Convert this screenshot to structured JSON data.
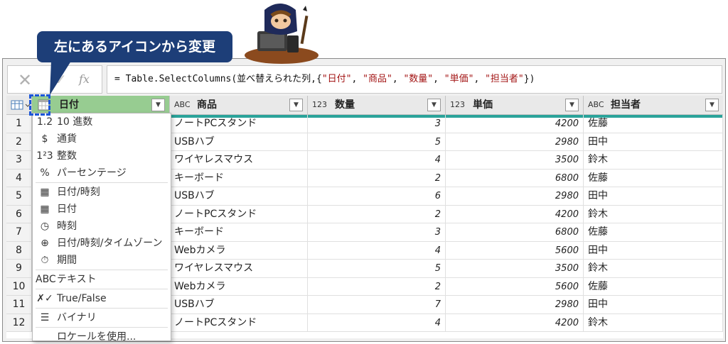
{
  "callout": {
    "text": "左にあるアイコンから変更"
  },
  "formula": {
    "cancel_icon": "close-icon",
    "confirm_icon": "check-icon",
    "fx_label": "fx",
    "prefix": "= Table.SelectColumns(並べ替えられた列,{",
    "args": [
      "\"日付\"",
      "\"商品\"",
      "\"数量\"",
      "\"単価\"",
      "\"担当者\""
    ],
    "sep": ", ",
    "suffix": "})"
  },
  "columns": [
    {
      "type": "date",
      "label": "日付"
    },
    {
      "type": "ABC",
      "label": "商品"
    },
    {
      "type": "123",
      "label": "数量"
    },
    {
      "type": "123",
      "label": "単価"
    },
    {
      "type": "ABC",
      "label": "担当者"
    }
  ],
  "row_numbers": [
    "1",
    "2",
    "3",
    "4",
    "5",
    "6",
    "7",
    "8",
    "9",
    "10",
    "11",
    "12"
  ],
  "rows": [
    {
      "product": "ノートPCスタンド",
      "qty": "3",
      "price": "4200",
      "person": "佐藤"
    },
    {
      "product": "USBハブ",
      "qty": "5",
      "price": "2980",
      "person": "田中"
    },
    {
      "product": "ワイヤレスマウス",
      "qty": "4",
      "price": "3500",
      "person": "鈴木"
    },
    {
      "product": "キーボード",
      "qty": "2",
      "price": "6800",
      "person": "佐藤"
    },
    {
      "product": "USBハブ",
      "qty": "6",
      "price": "2980",
      "person": "田中"
    },
    {
      "product": "ノートPCスタンド",
      "qty": "2",
      "price": "4200",
      "person": "鈴木"
    },
    {
      "product": "キーボード",
      "qty": "3",
      "price": "6800",
      "person": "佐藤"
    },
    {
      "product": "Webカメラ",
      "qty": "4",
      "price": "5600",
      "person": "田中"
    },
    {
      "product": "ワイヤレスマウス",
      "qty": "5",
      "price": "3500",
      "person": "鈴木"
    },
    {
      "product": "Webカメラ",
      "qty": "2",
      "price": "5600",
      "person": "佐藤"
    },
    {
      "product": "USBハブ",
      "qty": "7",
      "price": "2980",
      "person": "田中"
    },
    {
      "product": "ノートPCスタンド",
      "qty": "4",
      "price": "4200",
      "person": "鈴木"
    }
  ],
  "type_menu": {
    "groups": [
      [
        {
          "icon": "decimal-icon",
          "glyph": "1.2",
          "label": "10 進数"
        },
        {
          "icon": "currency-icon",
          "glyph": "$",
          "label": "通貨"
        },
        {
          "icon": "integer-icon",
          "glyph": "1²3",
          "label": "整数"
        },
        {
          "icon": "percent-icon",
          "glyph": "%",
          "label": "パーセンテージ"
        }
      ],
      [
        {
          "icon": "datetime-icon",
          "glyph": "▦",
          "label": "日付/時刻"
        },
        {
          "icon": "date-icon",
          "glyph": "▦",
          "label": "日付"
        },
        {
          "icon": "time-icon",
          "glyph": "◷",
          "label": "時刻"
        },
        {
          "icon": "datetimezone-icon",
          "glyph": "⊕",
          "label": "日付/時刻/タイムゾーン"
        },
        {
          "icon": "duration-icon",
          "glyph": "⏱",
          "label": "期間"
        }
      ],
      [
        {
          "icon": "text-icon",
          "glyph": "ABC",
          "label": "テキスト"
        }
      ],
      [
        {
          "icon": "boolean-icon",
          "glyph": "✗✓",
          "label": "True/False"
        }
      ],
      [
        {
          "icon": "binary-icon",
          "glyph": "☰",
          "label": "バイナリ"
        }
      ],
      [
        {
          "icon": "",
          "glyph": "",
          "label": "ロケールを使用..."
        }
      ]
    ]
  },
  "colors": {
    "selected_header": "#97cc91",
    "accent": "#2aa39a",
    "callout": "#1d3e78",
    "highlight": "#1b56d8"
  }
}
